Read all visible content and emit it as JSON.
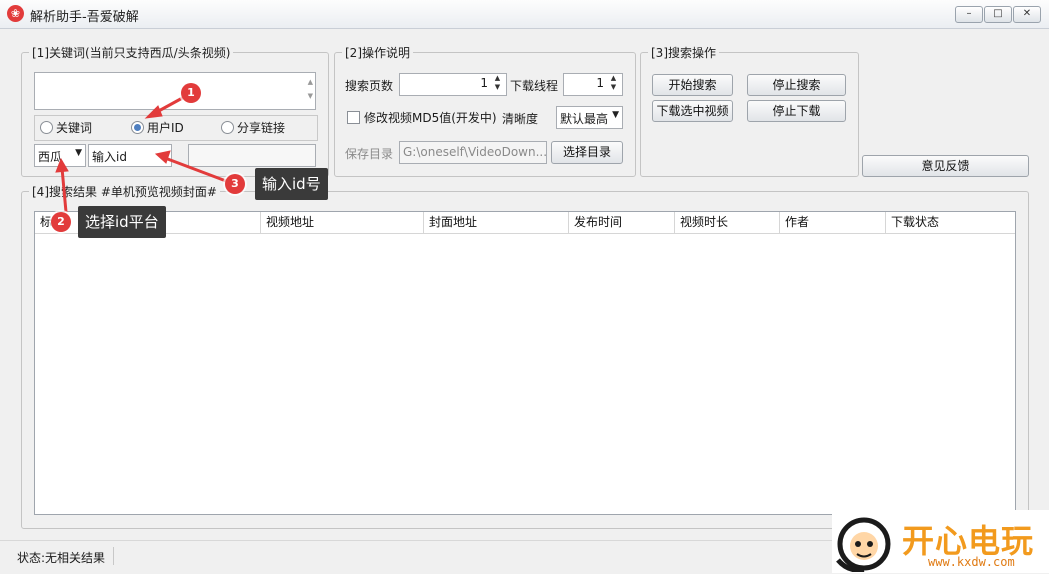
{
  "window": {
    "title": "解析助手-吾爱破解",
    "controls": {
      "minimize": "–",
      "maximize": "□",
      "close": "✕"
    }
  },
  "keyword_group": {
    "title": "[1]关键词(当前只支持西瓜/头条视频)",
    "keyword_input": "",
    "radio_options": [
      {
        "label": "关键词",
        "selected": false
      },
      {
        "label": "用户ID",
        "selected": true
      },
      {
        "label": "分享链接",
        "selected": false
      }
    ],
    "platform_select": "西瓜",
    "user_id_input": "输入id",
    "extra_input": ""
  },
  "operation_group": {
    "title": "[2]操作说明",
    "pages_label": "搜索页数",
    "pages_value": "1",
    "threads_label": "下载线程",
    "threads_value": "1",
    "md5_label": "修改视频MD5值(开发中)",
    "md5_checked": false,
    "quality_label": "清晰度",
    "quality_value": "默认最高",
    "save_dir_label": "保存目录",
    "save_dir_value": "G:\\oneself\\VideoDown...",
    "choose_dir_button": "选择目录"
  },
  "search_group": {
    "title": "[3]搜索操作",
    "start_search": "开始搜索",
    "stop_search": "停止搜索",
    "download_selected": "下载选中视频",
    "stop_download": "停止下载"
  },
  "feedback_button": "意见反馈",
  "results_group": {
    "title": "[4]搜索结果 #单机预览视频封面#",
    "columns": [
      "标题",
      "视频地址",
      "封面地址",
      "发布时间",
      "视频时长",
      "作者",
      "下载状态"
    ],
    "rows": []
  },
  "annotations": {
    "step1": "1",
    "step2": "2",
    "step2_text": "选择id平台",
    "step3": "3",
    "step3_text": "输入id号",
    "accent_color": "#e23b3b"
  },
  "status": {
    "text": "状态:无相关结果"
  },
  "watermark": {
    "brand": "开心电玩",
    "url": "www.kxdw.com"
  }
}
